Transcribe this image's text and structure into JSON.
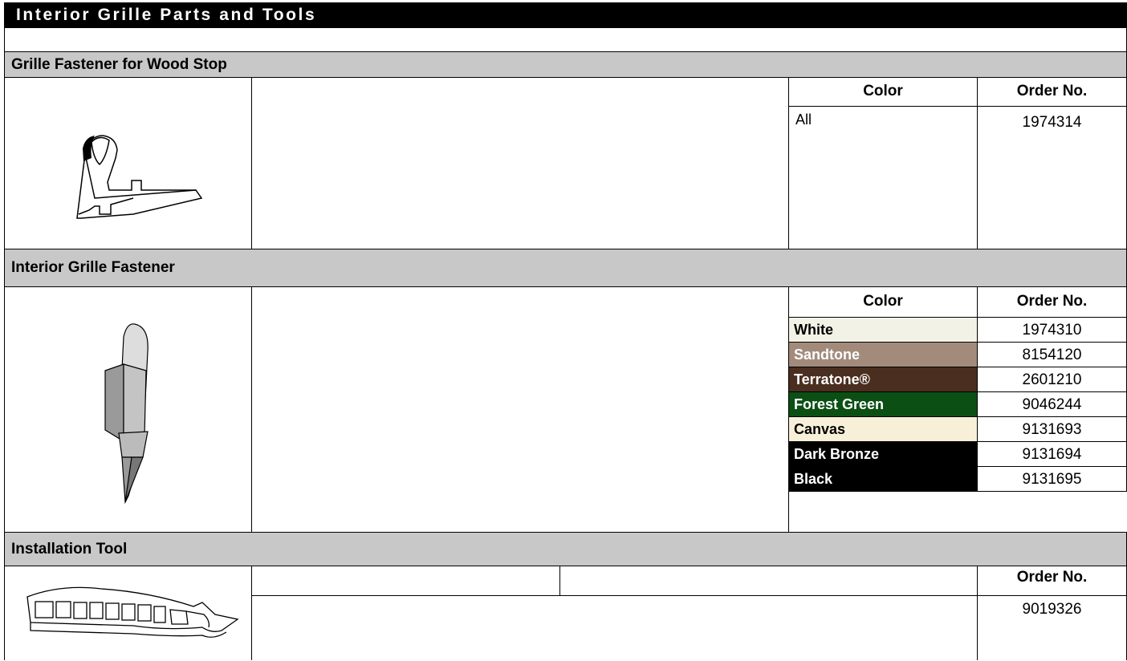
{
  "page_title": "Interior Grille Parts and Tools",
  "section1": {
    "heading": "Grille Fastener for Wood Stop",
    "col_color": "Color",
    "col_order": "Order No.",
    "rows": [
      {
        "color": "All",
        "order": "1974314"
      }
    ]
  },
  "section2": {
    "heading": "Interior Grille Fastener",
    "col_color": "Color",
    "col_order": "Order No.",
    "rows": [
      {
        "color": "White",
        "order": "1974310",
        "bg": "#f3f2e6",
        "fg": "#000000"
      },
      {
        "color": "Sandtone",
        "order": "8154120",
        "bg": "#a38b7c",
        "fg": "#ffffff"
      },
      {
        "color": "Terratone®",
        "order": "2601210",
        "bg": "#4a2e20",
        "fg": "#ffffff"
      },
      {
        "color": "Forest Green",
        "order": "9046244",
        "bg": "#0b4f14",
        "fg": "#ffffff"
      },
      {
        "color": "Canvas",
        "order": "9131693",
        "bg": "#f7efd7",
        "fg": "#000000"
      },
      {
        "color": "Dark Bronze",
        "order": "9131694",
        "bg": "#000000",
        "fg": "#ffffff"
      },
      {
        "color": "Black",
        "order": "9131695",
        "bg": "#000000",
        "fg": "#ffffff"
      }
    ]
  },
  "section3": {
    "heading": "Installation Tool",
    "col_order": "Order No.",
    "order": "9019326"
  }
}
